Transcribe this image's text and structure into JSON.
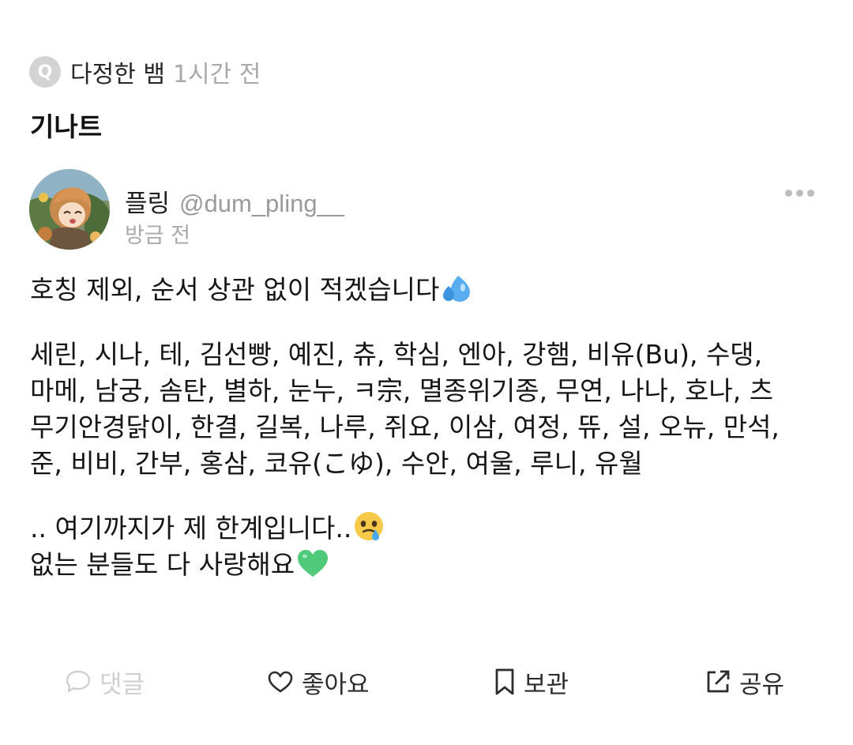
{
  "question": {
    "badge": "Q",
    "author": "다정한 뱀",
    "time": "1시간 전",
    "title": "기나트"
  },
  "answer": {
    "author_name": "플링",
    "author_handle": "@dum_pling__",
    "time": "방금 전",
    "lines": {
      "l1": "호칭 제외, 순서 상관 없이 적겠습니다",
      "l2": "세린, 시나, 테, 김선빵, 예진, 츄, 학심, 엔아, 강햄, 비유(Bu), 수댕,",
      "l3": "마메, 남궁, 솜탄, 별하, 눈누, ㅋ宗, 멸종위기종, 무연, 나나, 호나, 츠",
      "l4": "무기안경닭이, 한결, 길복, 나루, 쥐요, 이삼, 여정, 뜌, 설, 오뉴, 만석,",
      "l5": "준, 비비, 간부, 홍삼, 코유(こゆ), 수안, 여울, 루니, 유월",
      "l6": ".. 여기까지가 제 한계입니다..",
      "l7": "없는 분들도 다 사랑해요"
    },
    "emojis": [
      "sweat-droplets-icon",
      "face-holding-back-tears-icon",
      "green-heart-icon"
    ]
  },
  "actions": {
    "comment": "댓글",
    "like": "좋아요",
    "save": "보관",
    "share": "공유"
  },
  "colors": {
    "muted": "#a9a9a9",
    "disabled": "#cfcfcf",
    "text": "#151515",
    "green_heart": "#4fc97a",
    "droplet": "#5aaef0"
  }
}
